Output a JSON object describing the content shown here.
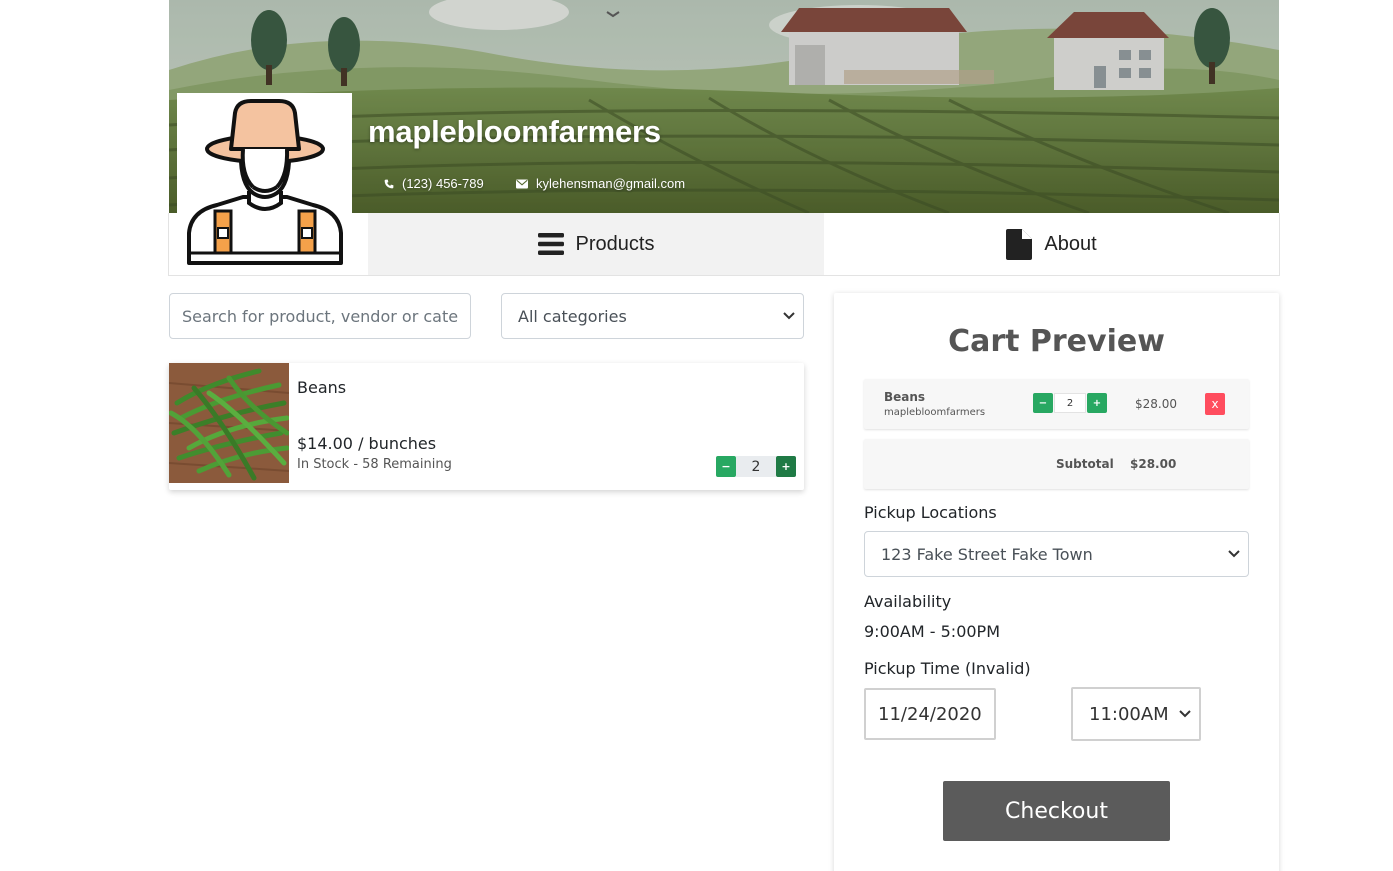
{
  "vendor": {
    "name": "maplebloomfarmers",
    "phone": "(123) 456-789",
    "email": "kylehensman@gmail.com"
  },
  "icons": {
    "phone": "phone-icon",
    "email": "envelope-icon",
    "products_tab": "bars-icon",
    "about_tab": "file-icon",
    "select": "chevron-down-icon"
  },
  "tabs": {
    "products": "Products",
    "about": "About",
    "active": "products"
  },
  "filters": {
    "search_placeholder": "Search for product, vendor or category",
    "category_selected": "All categories"
  },
  "products": [
    {
      "name": "Beans",
      "price": "$14.00 / bunches",
      "stock": "In Stock - 58 Remaining",
      "quantity": "2",
      "minus": "−",
      "plus": "+"
    }
  ],
  "cart": {
    "title": "Cart Preview",
    "items": [
      {
        "name": "Beans",
        "vendor": "maplebloomfarmers",
        "quantity": "2",
        "price": "$28.00",
        "minus": "−",
        "plus": "+",
        "remove": "x"
      }
    ],
    "subtotal_label": "Subtotal",
    "subtotal_value": "$28.00",
    "pickup_label": "Pickup Locations",
    "pickup_selected": "123 Fake Street Fake Town",
    "availability_label": "Availability",
    "availability_value": "9:00AM - 5:00PM",
    "pickup_time_label": "Pickup Time (Invalid)",
    "pickup_date": "11/24/2020",
    "pickup_time": "11:00AM",
    "checkout_label": "Checkout"
  },
  "colors": {
    "qty_minus": "#28a862",
    "qty_plus": "#1f7a45",
    "remove": "#ff4d5e",
    "checkout": "#5b5b5b",
    "active_tab_bg": "#f2f2f2"
  }
}
